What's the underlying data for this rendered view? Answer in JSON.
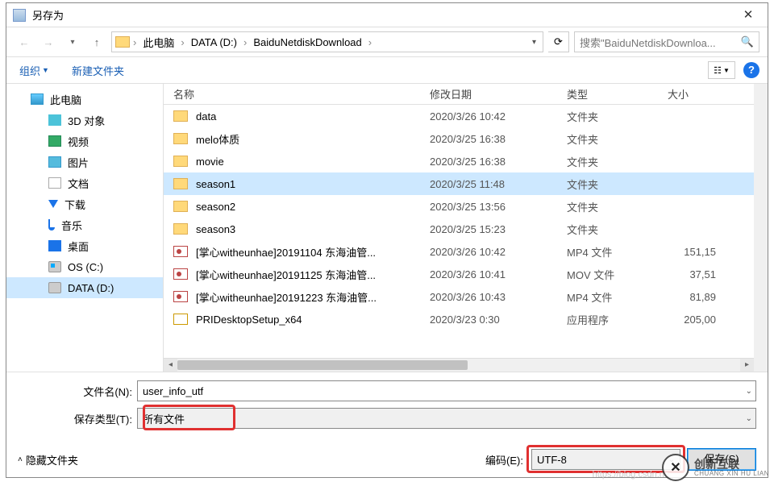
{
  "title": "另存为",
  "breadcrumb": {
    "pc": "此电脑",
    "drive": "DATA (D:)",
    "folder": "BaiduNetdiskDownload"
  },
  "search_placeholder": "搜索\"BaiduNetdiskDownloa...",
  "toolbar": {
    "organize": "组织",
    "newfolder": "新建文件夹"
  },
  "sidebar": {
    "thispc": "此电脑",
    "items": [
      {
        "label": "3D 对象"
      },
      {
        "label": "视频"
      },
      {
        "label": "图片"
      },
      {
        "label": "文档"
      },
      {
        "label": "下载"
      },
      {
        "label": "音乐"
      },
      {
        "label": "桌面"
      },
      {
        "label": "OS (C:)"
      },
      {
        "label": "DATA (D:)"
      }
    ]
  },
  "columns": {
    "name": "名称",
    "date": "修改日期",
    "type": "类型",
    "size": "大小"
  },
  "files": [
    {
      "name": "data",
      "date": "2020/3/26 10:42",
      "type": "文件夹",
      "size": "",
      "kind": "folder"
    },
    {
      "name": "melo体质",
      "date": "2020/3/25 16:38",
      "type": "文件夹",
      "size": "",
      "kind": "folder"
    },
    {
      "name": "movie",
      "date": "2020/3/25 16:38",
      "type": "文件夹",
      "size": "",
      "kind": "folder"
    },
    {
      "name": "season1",
      "date": "2020/3/25 11:48",
      "type": "文件夹",
      "size": "",
      "kind": "folder",
      "selected": true
    },
    {
      "name": "season2",
      "date": "2020/3/25 13:56",
      "type": "文件夹",
      "size": "",
      "kind": "folder"
    },
    {
      "name": "season3",
      "date": "2020/3/25 15:23",
      "type": "文件夹",
      "size": "",
      "kind": "folder"
    },
    {
      "name": "[掌心witheunhae]20191104 东海油管...",
      "date": "2020/3/26 10:42",
      "type": "MP4 文件",
      "size": "151,15",
      "kind": "file"
    },
    {
      "name": "[掌心witheunhae]20191125 东海油管...",
      "date": "2020/3/26 10:41",
      "type": "MOV 文件",
      "size": "37,51",
      "kind": "file"
    },
    {
      "name": "[掌心witheunhae]20191223 东海油管...",
      "date": "2020/3/26 10:43",
      "type": "MP4 文件",
      "size": "81,89",
      "kind": "file"
    },
    {
      "name": "PRIDesktopSetup_x64",
      "date": "2020/3/23 0:30",
      "type": "应用程序",
      "size": "205,00",
      "kind": "exe"
    }
  ],
  "form": {
    "filename_label": "文件名(N):",
    "filename_value": "user_info_utf",
    "filetype_label": "保存类型(T):",
    "filetype_value": "所有文件"
  },
  "footer": {
    "hide": "隐藏文件夹",
    "encoding_label": "编码(E):",
    "encoding_value": "UTF-8",
    "save": "保存(S)"
  },
  "watermark": {
    "brand": "创新互联",
    "sub": "CHUANG XIN HU LIAN",
    "url": "https://blog.csdn.ne"
  }
}
